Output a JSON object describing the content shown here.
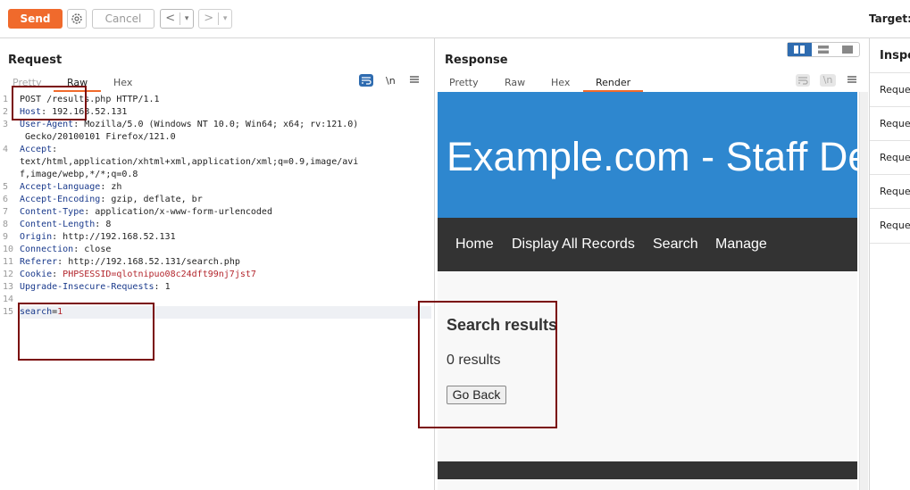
{
  "toolbar": {
    "send_label": "Send",
    "cancel_label": "Cancel",
    "back_glyph": "<",
    "forward_glyph": ">",
    "dropdown_glyph": "▾",
    "target_label": "Target: h"
  },
  "request": {
    "title": "Request",
    "tabs": [
      "Pretty",
      "Raw",
      "Hex"
    ],
    "active_tab": "Raw",
    "newline_toggle": "\\n",
    "lines": [
      {
        "n": "1",
        "name": "",
        "sep": "",
        "value": "POST /results.php HTTP/1.1"
      },
      {
        "n": "2",
        "name": "Host",
        "sep": ": ",
        "value": "192.168.52.131"
      },
      {
        "n": "3",
        "name": "User-Agent",
        "sep": ": ",
        "value": "Mozilla/5.0 (Windows NT 10.0; Win64; x64; rv:121.0)"
      },
      {
        "n": "",
        "name": "",
        "sep": "",
        "value": " Gecko/20100101 Firefox/121.0"
      },
      {
        "n": "4",
        "name": "Accept",
        "sep": ":",
        "value": ""
      },
      {
        "n": "",
        "name": "",
        "sep": "",
        "value": "text/html,application/xhtml+xml,application/xml;q=0.9,image/avi"
      },
      {
        "n": "",
        "name": "",
        "sep": "",
        "value": "f,image/webp,*/*;q=0.8"
      },
      {
        "n": "5",
        "name": "Accept-Language",
        "sep": ": ",
        "value": "zh"
      },
      {
        "n": "6",
        "name": "Accept-Encoding",
        "sep": ": ",
        "value": "gzip, deflate, br"
      },
      {
        "n": "7",
        "name": "Content-Type",
        "sep": ": ",
        "value": "application/x-www-form-urlencoded"
      },
      {
        "n": "8",
        "name": "Content-Length",
        "sep": ": ",
        "value": "8"
      },
      {
        "n": "9",
        "name": "Origin",
        "sep": ": ",
        "value": "http://192.168.52.131"
      },
      {
        "n": "10",
        "name": "Connection",
        "sep": ": ",
        "value": "close"
      },
      {
        "n": "11",
        "name": "Referer",
        "sep": ": ",
        "value": "http://192.168.52.131/search.php"
      },
      {
        "n": "12",
        "name": "Cookie",
        "sep": ": ",
        "value": "PHPSESSID=qlotnipuo08c24dft99nj7jst7"
      },
      {
        "n": "13",
        "name": "Upgrade-Insecure-Requests",
        "sep": ": ",
        "value": "1"
      },
      {
        "n": "14",
        "name": "",
        "sep": "",
        "value": ""
      },
      {
        "n": "15",
        "name": "search",
        "sep": "=",
        "value": "1"
      }
    ]
  },
  "response": {
    "title": "Response",
    "tabs": [
      "Pretty",
      "Raw",
      "Hex",
      "Render"
    ],
    "active_tab": "Render",
    "newline_toggle": "\\n",
    "render": {
      "site_title": "Example.com - Staff Details",
      "nav": [
        "Home",
        "Display All Records",
        "Search",
        "Manage"
      ],
      "results_heading": "Search results",
      "results_count": "0 results",
      "go_back_label": "Go Back"
    }
  },
  "inspector": {
    "title": "Inspector",
    "rows": [
      "Request attributes",
      "Request query parameters",
      "Request body parameters",
      "Request cookies",
      "Request headers"
    ]
  },
  "colors": {
    "send": "#f06a2c",
    "site_header": "#2e87cf",
    "site_nav": "#333333",
    "annotation": "#7a0a0a",
    "toggle_active": "#2f6cb0"
  }
}
